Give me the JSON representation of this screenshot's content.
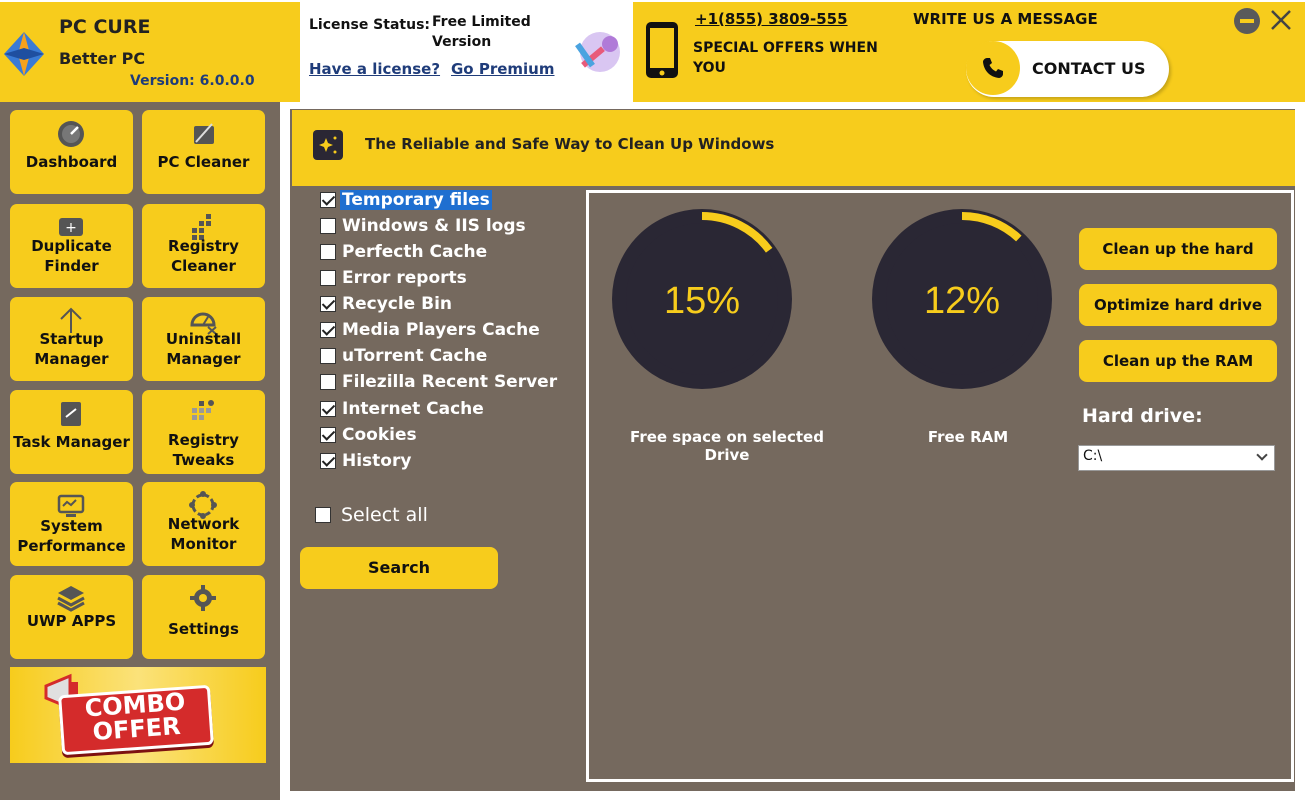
{
  "app": {
    "name": "PC CURE",
    "subtitle": "Better PC",
    "version": "Version: 6.0.0.0"
  },
  "license": {
    "label": "License Status:",
    "value": "Free Limited Version",
    "have_license": "Have a license?",
    "go_premium": "Go Premium"
  },
  "contact": {
    "phone": "+1(855) 3809-555",
    "special_offers": "SPECIAL OFFERS  WHEN YOU",
    "write_us": "WRITE US A MESSAGE",
    "contact_label": "CONTACT US"
  },
  "sidebar": {
    "items": [
      {
        "label": "Dashboard",
        "icon": "speedometer-icon"
      },
      {
        "label": "PC Cleaner",
        "icon": "broom-icon"
      },
      {
        "label": "Duplicate Finder",
        "icon": "duplicate-icon"
      },
      {
        "label": "Registry Cleaner",
        "icon": "registry-icon"
      },
      {
        "label": "Startup Manager",
        "icon": "arrow-up-icon"
      },
      {
        "label": "Uninstall Manager",
        "icon": "uninstall-icon"
      },
      {
        "label": "Task Manager",
        "icon": "clipboard-icon"
      },
      {
        "label": "Registry Tweaks",
        "icon": "tweaks-icon"
      },
      {
        "label": "System Performance",
        "icon": "monitor-icon"
      },
      {
        "label": "Network Monitor",
        "icon": "network-icon"
      },
      {
        "label": "UWP APPS",
        "icon": "layers-icon"
      },
      {
        "label": "Settings",
        "icon": "gear-icon"
      }
    ],
    "combo_line1": "COMBO",
    "combo_line2": "OFFER"
  },
  "main": {
    "banner_text": "The Reliable and Safe Way to Clean Up Windows",
    "checklist": [
      {
        "label": "Temporary files",
        "checked": true,
        "selected": true
      },
      {
        "label": "Windows &  IIS logs",
        "checked": false
      },
      {
        "label": "Perfecth Cache",
        "checked": false
      },
      {
        "label": "Error reports",
        "checked": false
      },
      {
        "label": "Recycle Bin",
        "checked": true
      },
      {
        "label": "Media Players Cache",
        "checked": true
      },
      {
        "label": "uTorrent Cache",
        "checked": false
      },
      {
        "label": "Filezilla Recent Server",
        "checked": false
      },
      {
        "label": "Internet Cache",
        "checked": true
      },
      {
        "label": "Cookies",
        "checked": true
      },
      {
        "label": "History",
        "checked": true
      }
    ],
    "select_all": "Select all",
    "search_label": "Search",
    "gauges": [
      {
        "value": 15,
        "text": "15%",
        "label": "Free space on selected Drive"
      },
      {
        "value": 12,
        "text": "12%",
        "label": "Free RAM"
      }
    ],
    "actions": [
      "Clean up the hard drive",
      "Optimize hard drive",
      "Clean up the RAM"
    ],
    "hard_drive_label": "Hard drive:",
    "hard_drive_value": "C:\\"
  },
  "colors": {
    "accent": "#f7cc1c",
    "panel_bg": "#75695e",
    "gauge_bg": "#2a2734",
    "gauge_text": "#f7cc1c"
  }
}
